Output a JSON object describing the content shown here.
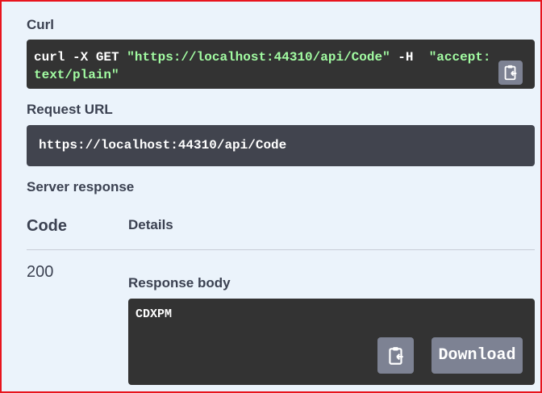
{
  "curl": {
    "label": "Curl",
    "cmd_prefix": "curl -X GET ",
    "url_string": "\"https://localhost:44310/api/Code\"",
    "flag": " -H  ",
    "header_part1": "\"accept:",
    "header_part2": "text/plain\"",
    "copy_icon": "clipboard-copy-icon"
  },
  "request_url": {
    "label": "Request URL",
    "value": "https://localhost:44310/api/Code"
  },
  "server_response": {
    "label": "Server response",
    "col_code": "Code",
    "col_details": "Details",
    "code": "200",
    "response_body_label": "Response body",
    "body": "CDXPM",
    "copy_icon": "clipboard-copy-icon",
    "download_label": "Download"
  },
  "colors": {
    "frame_border": "#e8141d",
    "background": "#ebf3fb",
    "code_bg": "#333333",
    "string_green": "#a2fca2",
    "button_gray": "#7d8293"
  }
}
